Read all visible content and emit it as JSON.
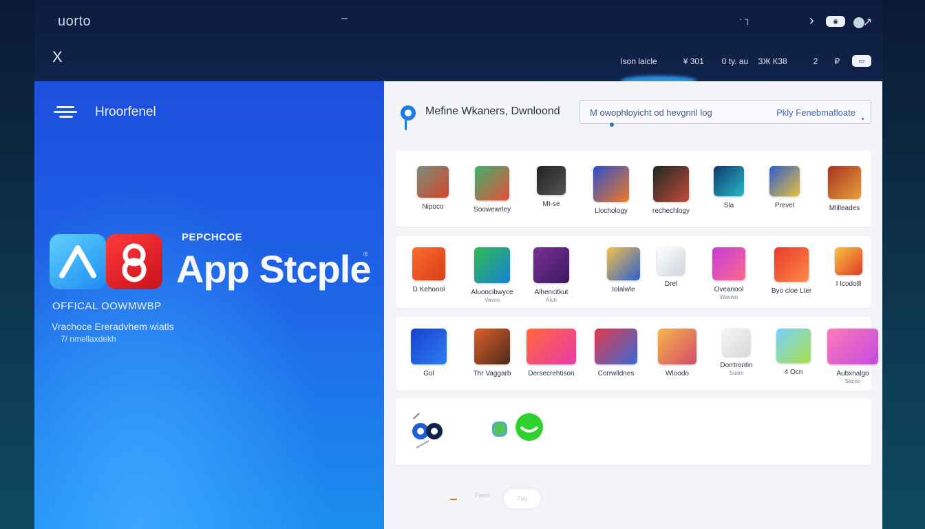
{
  "colors": {
    "accent": "#1e63e6",
    "hero_bottom": "#1c8ef0",
    "brand_red": "#d91620",
    "brand_cyan": "#35b2f7"
  },
  "topbar": {
    "logo": "uorto",
    "dash": "–",
    "glyph": "·  ┐",
    "chevron": "›",
    "pill": "◉",
    "toggle_arrow": "↗",
    "close": "X",
    "nav": [
      "Ison laicle",
      "¥ 301",
      "0 ty. au",
      "ЗЖ КЗ8",
      "2",
      "₽",
      "▭"
    ]
  },
  "hero": {
    "nav_label": "Hroorfenel",
    "kicker": "PEPCHCOE",
    "brand": "App Stcple",
    "reg": "®",
    "official": "OFFICAL OOWMWBP",
    "desc_line1": "Vrachoce Ereradvhem wiatls",
    "desc_line2": "7/ nmellaxdekh"
  },
  "main": {
    "title": "Mefine Wkaners, Dwnloond",
    "search_placeholder": "M owophloyicht  od hevgnril log",
    "search_action": "Pkly Fenebmafloate",
    "rows": [
      [
        {
          "label": "Nipoco",
          "sub": "",
          "icon": "tool-app-icon",
          "c1": "#7a8f7a",
          "c2": "#d2452a"
        },
        {
          "label": "Soowewrley",
          "sub": "",
          "icon": "game-app-icon",
          "c1": "#3fb26a",
          "c2": "#e84d3c"
        },
        {
          "label": "MI-se",
          "sub": "",
          "icon": "dark-app-icon",
          "c1": "#222222",
          "c2": "#555555"
        },
        {
          "label": "Llochology",
          "sub": "",
          "icon": "action-app-icon",
          "c1": "#2b4fd1",
          "c2": "#f07a22"
        },
        {
          "label": "rechechlogy",
          "sub": "",
          "icon": "portrait-app-icon",
          "c1": "#1c2a22",
          "c2": "#c24a3a"
        },
        {
          "label": "Sla",
          "sub": "",
          "icon": "shield-app-icon",
          "c1": "#0b3a6a",
          "c2": "#2cb8c8"
        },
        {
          "label": "Prevel",
          "sub": "",
          "icon": "cartoon-app-icon",
          "c1": "#2f5bd0",
          "c2": "#e7c23a"
        },
        {
          "label": "Mlilleades",
          "sub": "",
          "icon": "adventure-app-icon",
          "c1": "#a8321e",
          "c2": "#e8a03a"
        }
      ],
      [
        {
          "label": "D Kehonol",
          "sub": "",
          "icon": "orange-app-icon",
          "c1": "#ff6a2a",
          "c2": "#d6401a"
        },
        {
          "label": "Aluoocibwyce",
          "sub": "Vavoo",
          "icon": "green-app-icon",
          "c1": "#2ebd4e",
          "c2": "#1a7fd6"
        },
        {
          "label": "Alhencitkut",
          "sub": "Aluh",
          "icon": "purple-app-icon",
          "c1": "#7a2f9a",
          "c2": "#3b1a5a"
        },
        {
          "label": "Iolalwle",
          "sub": "",
          "icon": "blue-face-app-icon",
          "c1": "#f4c24a",
          "c2": "#2a5fd0"
        },
        {
          "label": "Drel",
          "sub": "",
          "icon": "ghost-app-icon",
          "c1": "#ffffff",
          "c2": "#cfd5de"
        },
        {
          "label": "Oveanool",
          "sub": "Wavwo",
          "icon": "pink-app-icon",
          "c1": "#c23cd9",
          "c2": "#ff6a8a"
        },
        {
          "label": "Byo cloe Lter",
          "sub": "",
          "icon": "red-app-icon",
          "c1": "#e83a2a",
          "c2": "#ff8a4a"
        },
        {
          "label": "I Icodolll",
          "sub": "",
          "icon": "yellow-app-icon",
          "c1": "#f6c43a",
          "c2": "#e23a2a"
        }
      ],
      [
        {
          "label": "Gol",
          "sub": "",
          "icon": "camera-app-icon",
          "c1": "#1a3fd0",
          "c2": "#2a7ff0"
        },
        {
          "label": "Thr Vaggarb",
          "sub": "",
          "icon": "ball-app-icon",
          "c1": "#e0602a",
          "c2": "#4a2a1a"
        },
        {
          "label": "Dersecrehtison",
          "sub": "",
          "icon": "gradient-app-icon",
          "c1": "#ff6a3a",
          "c2": "#e83aa8"
        },
        {
          "label": "Corrwlldnes",
          "sub": "",
          "icon": "photo-app-icon",
          "c1": "#e23a4a",
          "c2": "#3a6ad6"
        },
        {
          "label": "Wloodo",
          "sub": "",
          "icon": "flower-app-icon",
          "c1": "#f4b84a",
          "c2": "#d64a6a"
        },
        {
          "label": "Dorrtrontin",
          "sub": "Suam",
          "icon": "text-app-icon",
          "c1": "#f6f6f6",
          "c2": "#d8d8d8"
        },
        {
          "label": "4 Ocn",
          "sub": "",
          "icon": "prism-app-icon",
          "c1": "#7ad0ff",
          "c2": "#a8e04a"
        },
        {
          "label": "Aubxnalgo",
          "sub": "Sacoo",
          "icon": "magenta-app-icon",
          "c1": "#ff7ab8",
          "c2": "#c24ae0"
        }
      ]
    ],
    "row4": [
      {
        "icon": "browser-app-icon"
      },
      {
        "icon": "chat-app-icon"
      }
    ],
    "pager": {
      "label": "Fweo",
      "current": "Fvo"
    }
  }
}
